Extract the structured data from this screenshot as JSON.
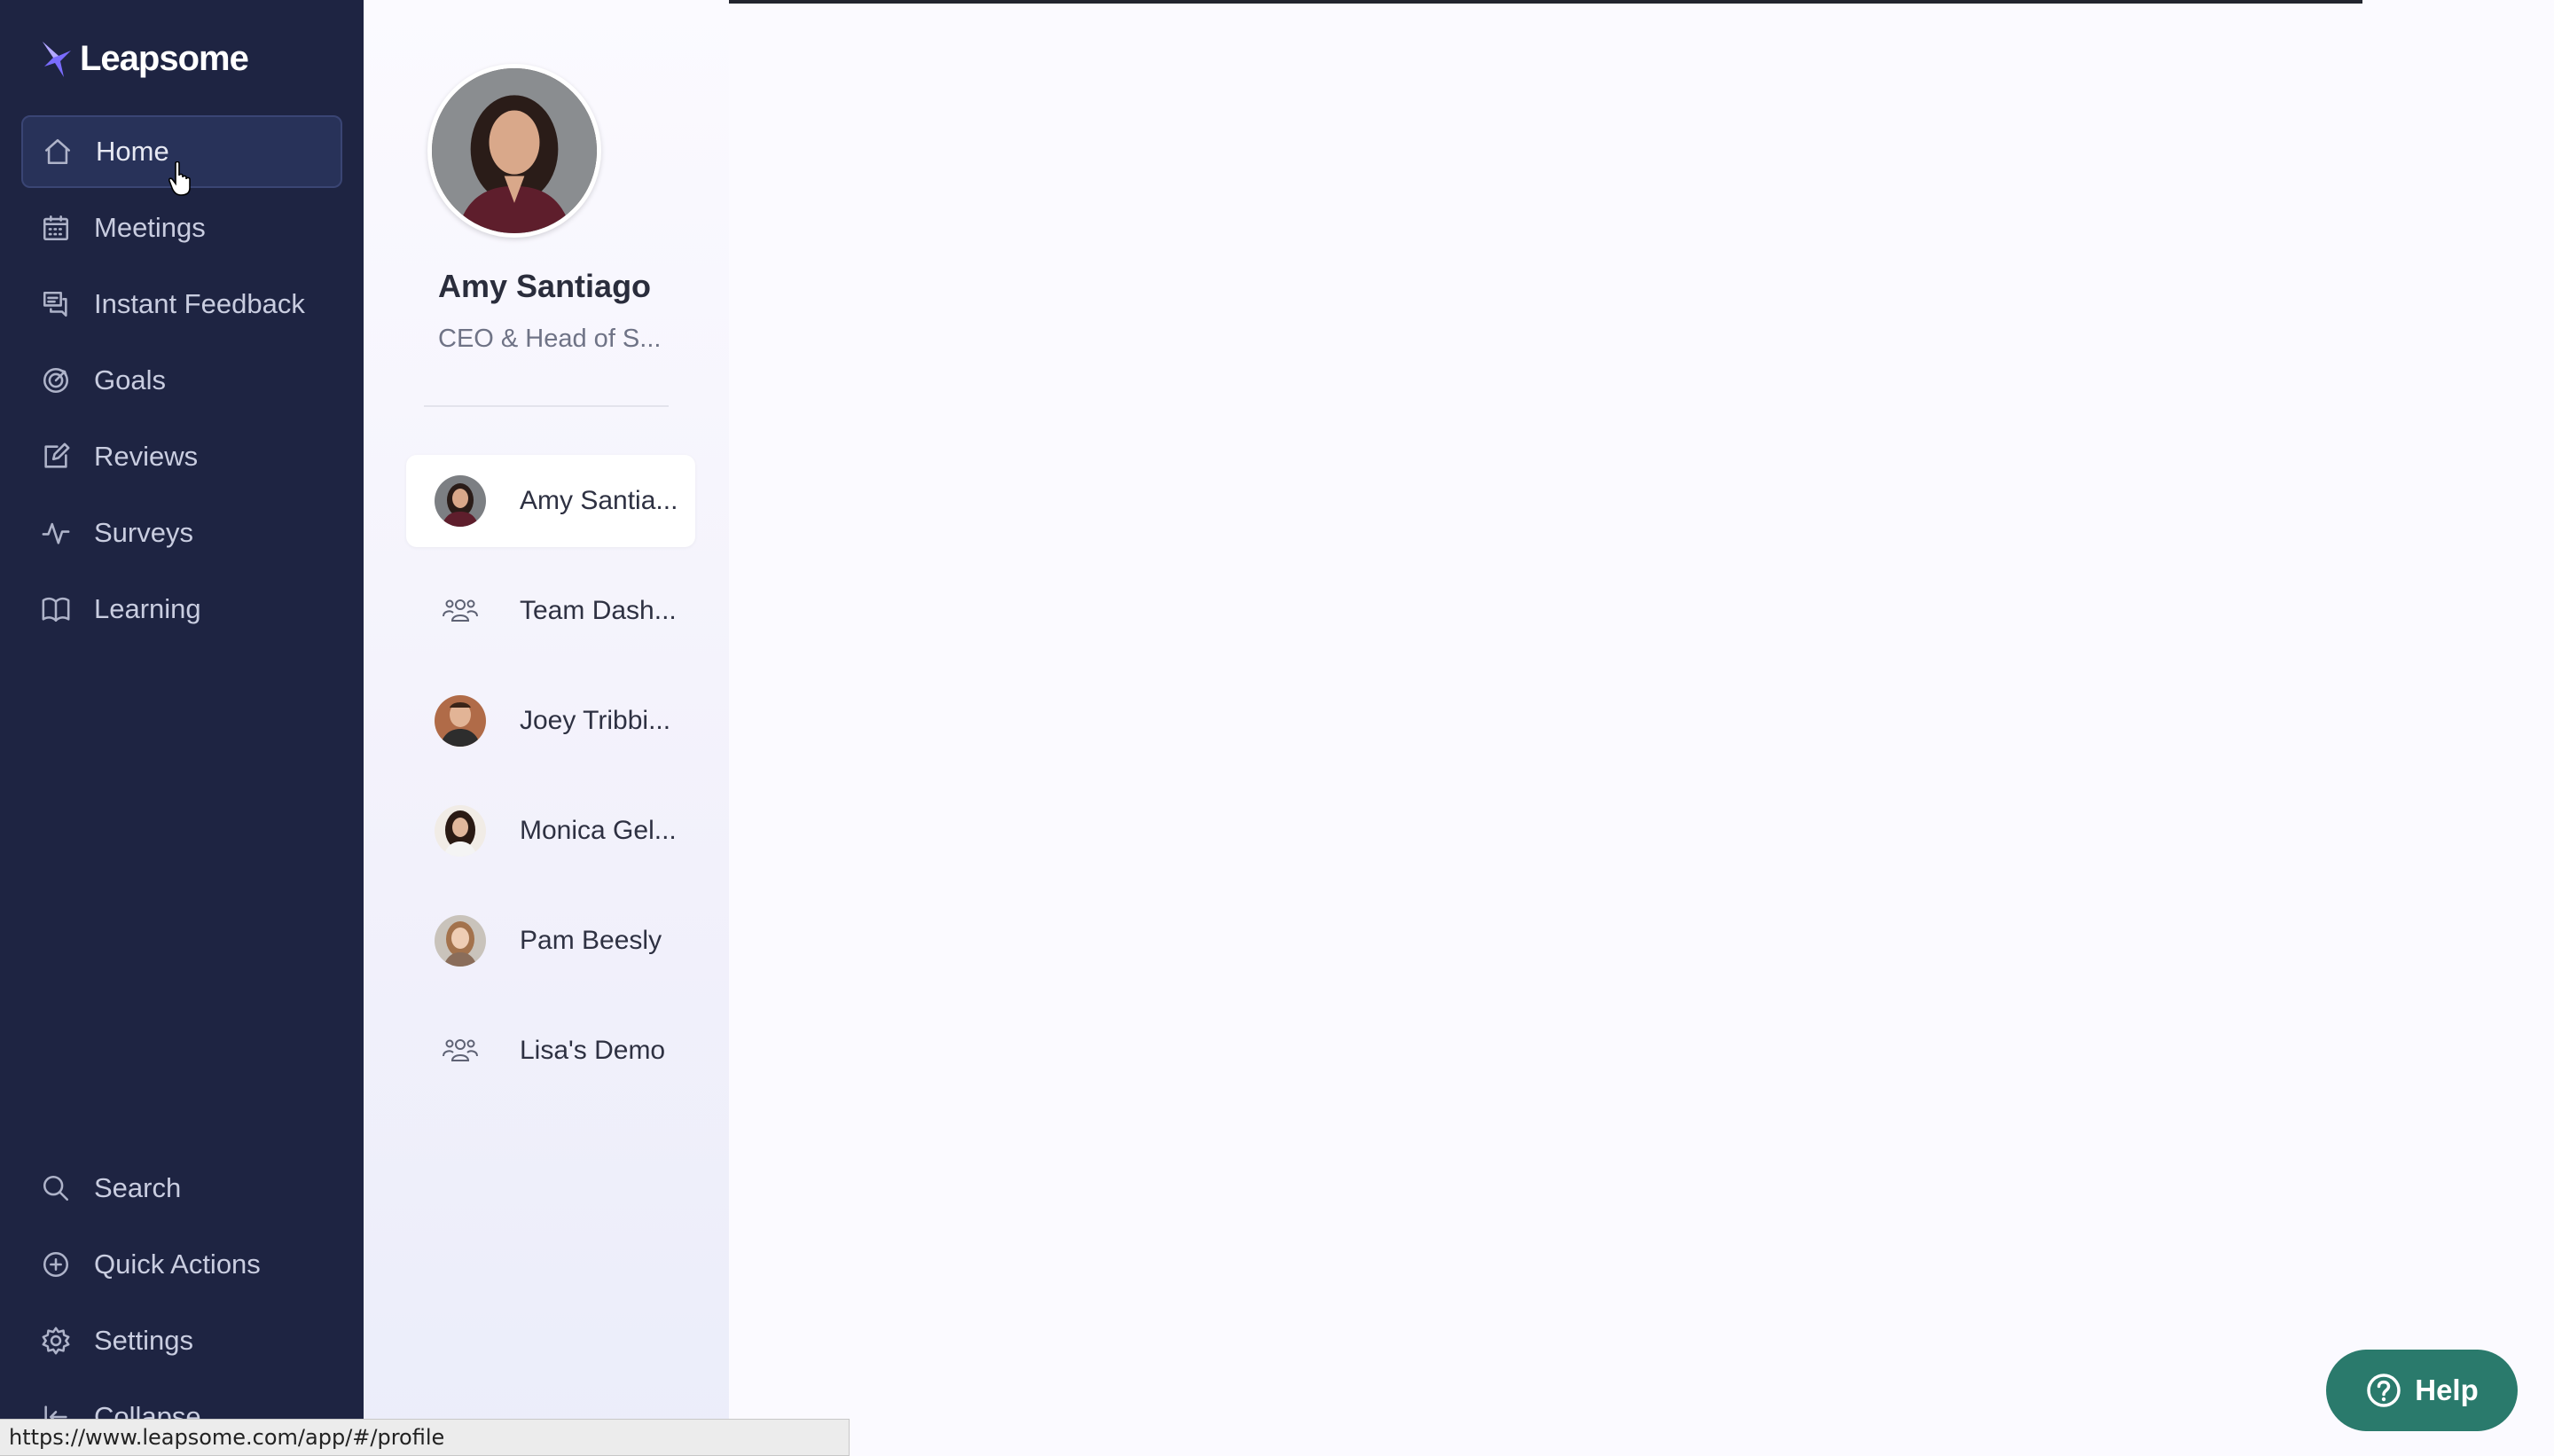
{
  "app": {
    "brand_name": "Leapsome"
  },
  "sidebar": {
    "items": [
      {
        "label": "Home",
        "icon": "home-icon",
        "active": true
      },
      {
        "label": "Meetings",
        "icon": "calendar-icon"
      },
      {
        "label": "Instant Feedback",
        "icon": "chat-icon"
      },
      {
        "label": "Goals",
        "icon": "target-icon"
      },
      {
        "label": "Reviews",
        "icon": "edit-icon"
      },
      {
        "label": "Surveys",
        "icon": "pulse-icon"
      },
      {
        "label": "Learning",
        "icon": "book-icon"
      }
    ],
    "bottom_items": [
      {
        "label": "Search",
        "icon": "search-icon"
      },
      {
        "label": "Quick Actions",
        "icon": "plus-circle-icon"
      },
      {
        "label": "Settings",
        "icon": "gear-icon"
      },
      {
        "label": "Collapse",
        "icon": "collapse-icon"
      }
    ]
  },
  "profile": {
    "name": "Amy Santiago",
    "title": "CEO & Head of S..."
  },
  "people": [
    {
      "label": "Amy Santia...",
      "type": "person",
      "selected": true
    },
    {
      "label": "Team Dash...",
      "type": "team"
    },
    {
      "label": "Joey Tribbi...",
      "type": "person"
    },
    {
      "label": "Monica Gel...",
      "type": "person"
    },
    {
      "label": "Pam Beesly",
      "type": "person"
    },
    {
      "label": "Lisa's Demo",
      "type": "team"
    }
  ],
  "help": {
    "label": "Help"
  },
  "status_url": "https://www.leapsome.com/app/#/profile",
  "colors": {
    "sidebar_bg": "#1e2442",
    "help_bg": "#2a7a6c",
    "brand_accent": "#6b63ff"
  }
}
